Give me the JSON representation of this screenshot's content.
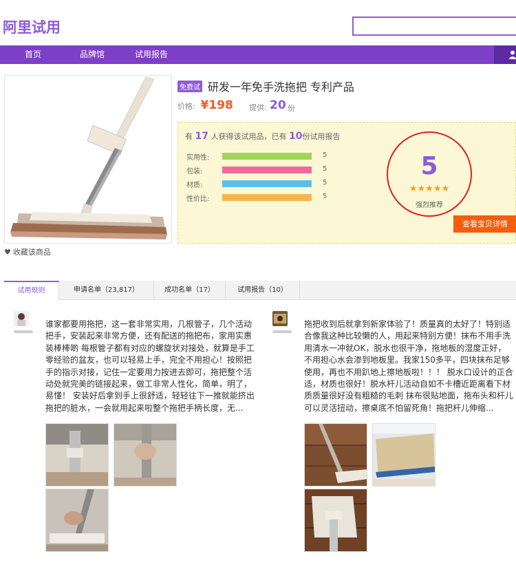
{
  "header": {
    "logo": "阿里试用",
    "search_placeholder": ""
  },
  "nav": {
    "items": [
      "首页",
      "品牌馆",
      "试用报告"
    ]
  },
  "product": {
    "free_tag": "免费试",
    "title": "研发一年免手洗拖把 专利产品",
    "price_label": "价格:",
    "price": "¥198",
    "supply_label": "提供:",
    "supply_count": "20",
    "supply_unit": "份",
    "favorite": "收藏该商品"
  },
  "info": {
    "prefix": "有",
    "applicants": "17",
    "mid": "人获得该试用品，已有",
    "reports": "10",
    "suffix": "份试用报告",
    "ratings": [
      {
        "label": "实用性:",
        "value": "5",
        "level": 1.0,
        "color": "#a3d45c"
      },
      {
        "label": "包装:",
        "value": "5",
        "level": 1.0,
        "color": "#f2689c"
      },
      {
        "label": "材质:",
        "value": "5",
        "level": 1.0,
        "color": "#5bc0e8"
      },
      {
        "label": "性价比:",
        "value": "5",
        "level": 1.0,
        "color": "#f9b34f"
      }
    ],
    "score": "5",
    "stars": "★★★★★",
    "recommend": "强烈推荐",
    "view_button": "查看宝贝详情"
  },
  "tabs": [
    "试用规则",
    "申请名单（23,817）",
    "成功名单（17）",
    "试用报告（10）"
  ],
  "reviews": [
    {
      "text": "谁家都要用拖把，这一套非常实用，几根管子，几个活动把手，安装起来非常方便，还有配送的拖把布，家用实惠装棒棒啲 每根管子都有对应的螺旋状对接处，就算是手工零经验的盆友，也可以轻易上手，完全不用担心！按照把手的指示对接，记住一定要用力按进去即可，拖把整个活动处就完美的链接起来，做工非常人性化，简单，明了，易懂！ 安装好后拿到手上很舒适，轻轻往下一推就能挤出拖把的脏水，一会就用起来啦整个拖把手柄长度，无..."
    },
    {
      "text": "拖把收到后就拿到新家体验了！质量真的太好了！特别适合像我这种比较懒的人，用起来特别方便！抹布不用手洗用清水一冲就OK，脱水也很干净，拖地板的湿度正好，不用担心水会渗到地板里。我家150多平，四块抹布足够使用，再也不用趴地上擦地板啦！！！ 脱水口设计的正合适，材质也很好！脱水杆儿活动自如不卡槽近距离看下材质质量很好没有粗糙的毛刺 抹布很贴地面，拖布头和杆儿可以灵活扭动，擦桌底不怕留死角！拖把杆儿伸缩..."
    }
  ]
}
